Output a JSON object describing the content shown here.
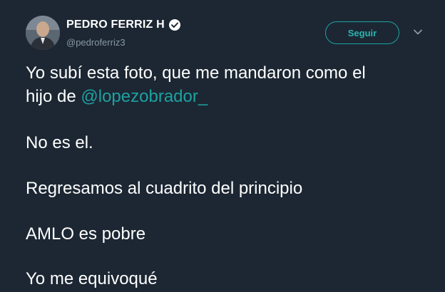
{
  "user": {
    "display_name": "PEDRO FERRIZ H",
    "handle": "@pedroferriz3",
    "verified_icon": "verified-badge-icon"
  },
  "actions": {
    "follow_label": "Seguir",
    "menu_icon": "chevron-down-icon"
  },
  "tweet": {
    "line1_text": "Yo subí esta foto, que me mandaron como el",
    "line2_prefix": "hijo de ",
    "mention": "@lopezobrador_",
    "para2": "No es el.",
    "para3": "Regresamos al cuadrito del principio",
    "para4": "AMLO es pobre",
    "para5": "Yo me equivoqué"
  },
  "colors": {
    "background": "#1c2733",
    "accent": "#1da1a1",
    "secondary_text": "#8899a6"
  }
}
